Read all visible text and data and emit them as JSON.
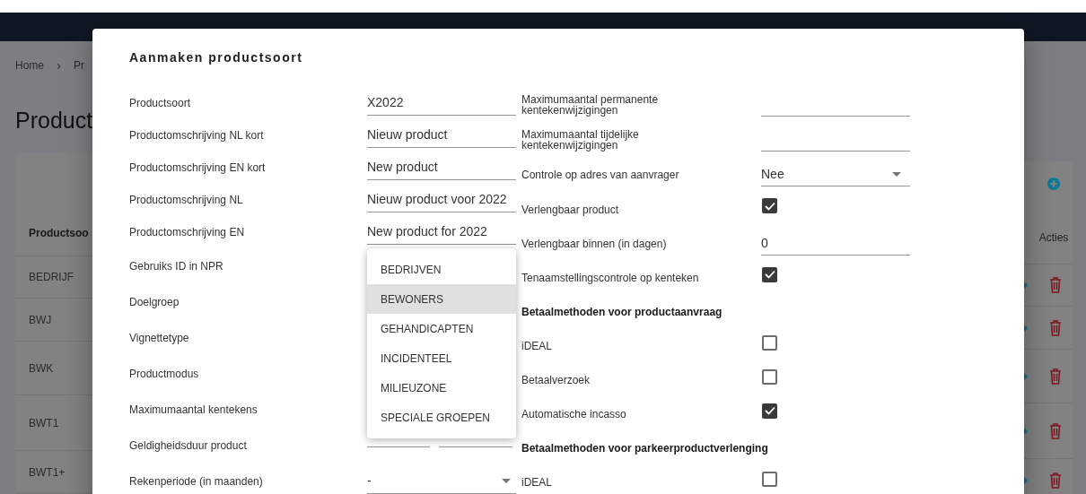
{
  "breadcrumb": {
    "home": "Home",
    "separator": "›",
    "current": "Pr"
  },
  "page_title": "Product",
  "table": {
    "columns": [
      "Productsoo",
      "Acties"
    ],
    "rows": [
      {
        "productsoort": "BEDRIJF"
      },
      {
        "productsoort": "BWJ"
      },
      {
        "productsoort": "BWK"
      },
      {
        "productsoort": "BWT1"
      },
      {
        "productsoort": "BWT1+"
      }
    ]
  },
  "dialog": {
    "title": "Aanmaken productsoort",
    "left_fields": [
      {
        "label": "Productsoort",
        "field": {
          "kind": "text",
          "value": "X2022"
        }
      },
      {
        "label": "Productomschrijving NL kort",
        "field": {
          "kind": "text",
          "value": "Nieuw product"
        }
      },
      {
        "label": "Productomschrijving EN kort",
        "field": {
          "kind": "text",
          "value": "New product"
        }
      },
      {
        "label": "Productomschrijving NL",
        "field": {
          "kind": "text",
          "value": "Nieuw product voor 2022"
        }
      },
      {
        "label": "Productomschrijving EN",
        "field": {
          "kind": "text",
          "value": "New product for 2022"
        }
      },
      {
        "label": "Gebruiks ID in NPR"
      },
      {
        "label": "Doelgroep"
      },
      {
        "label": "Vignettetype"
      },
      {
        "label": "Productmodus"
      },
      {
        "label": "Maximumaantal kentekens"
      },
      {
        "label": "Geldigheidsduur product",
        "field": {
          "kind": "pair"
        }
      },
      {
        "label": "Rekenperiode (in maanden)",
        "field": {
          "kind": "select",
          "value": "-"
        }
      }
    ],
    "right_fields": [
      {
        "kind": "text",
        "label": "Maximumaantal permanente kentekenwijzigingen"
      },
      {
        "kind": "text",
        "label": "Maximumaantal tijdelijke kentekenwijzigingen"
      },
      {
        "kind": "select",
        "label": "Controle op adres van aanvrager",
        "value": "Nee"
      },
      {
        "kind": "checkbox",
        "label": "Verlengbaar product",
        "checked": true
      },
      {
        "kind": "text",
        "label": "Verlengbaar binnen (in dagen)",
        "value": "0"
      },
      {
        "kind": "checkbox",
        "label": "Tenaamstellingscontrole op kenteken",
        "checked": true
      },
      {
        "kind": "heading",
        "label": "Betaalmethoden voor productaanvraag"
      },
      {
        "kind": "checkbox",
        "label": "iDEAL",
        "checked": false
      },
      {
        "kind": "checkbox",
        "label": "Betaalverzoek",
        "checked": false
      },
      {
        "kind": "checkbox",
        "label": "Automatische incasso",
        "checked": true
      },
      {
        "kind": "heading",
        "label": "Betaalmethoden voor parkeerproductverlenging"
      },
      {
        "kind": "checkbox",
        "label": "iDEAL",
        "checked": false
      }
    ],
    "dropdown": [
      {
        "label": "BEDRIJVEN",
        "selected": false
      },
      {
        "label": "BEWONERS",
        "selected": true
      },
      {
        "label": "GEHANDICAPTEN",
        "selected": false
      },
      {
        "label": "INCIDENTEEL",
        "selected": false
      },
      {
        "label": "MILIEUZONE",
        "selected": false
      },
      {
        "label": "SPECIALE GROEPEN",
        "selected": false
      }
    ]
  }
}
